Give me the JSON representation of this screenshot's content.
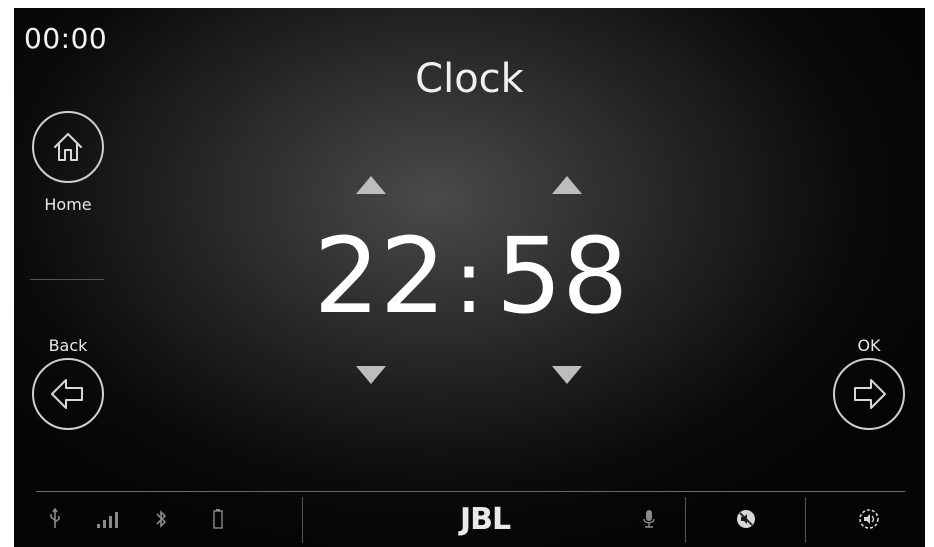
{
  "status": {
    "time": "00:00"
  },
  "header": {
    "title": "Clock"
  },
  "nav": {
    "home_label": "Home",
    "back_label": "Back",
    "ok_label": "OK"
  },
  "time_setter": {
    "hours": "22",
    "separator": ":",
    "minutes": "58"
  },
  "statusbar": {
    "icons": [
      "usb-icon",
      "signal-icon",
      "bluetooth-icon",
      "battery-icon",
      "microphone-icon",
      "mute-icon",
      "volume-icon"
    ],
    "brand": "JBL"
  },
  "colors": {
    "accent": "#ffffff",
    "arrow": "#bdbdbd",
    "muted_icon": "#8a8a8a"
  }
}
